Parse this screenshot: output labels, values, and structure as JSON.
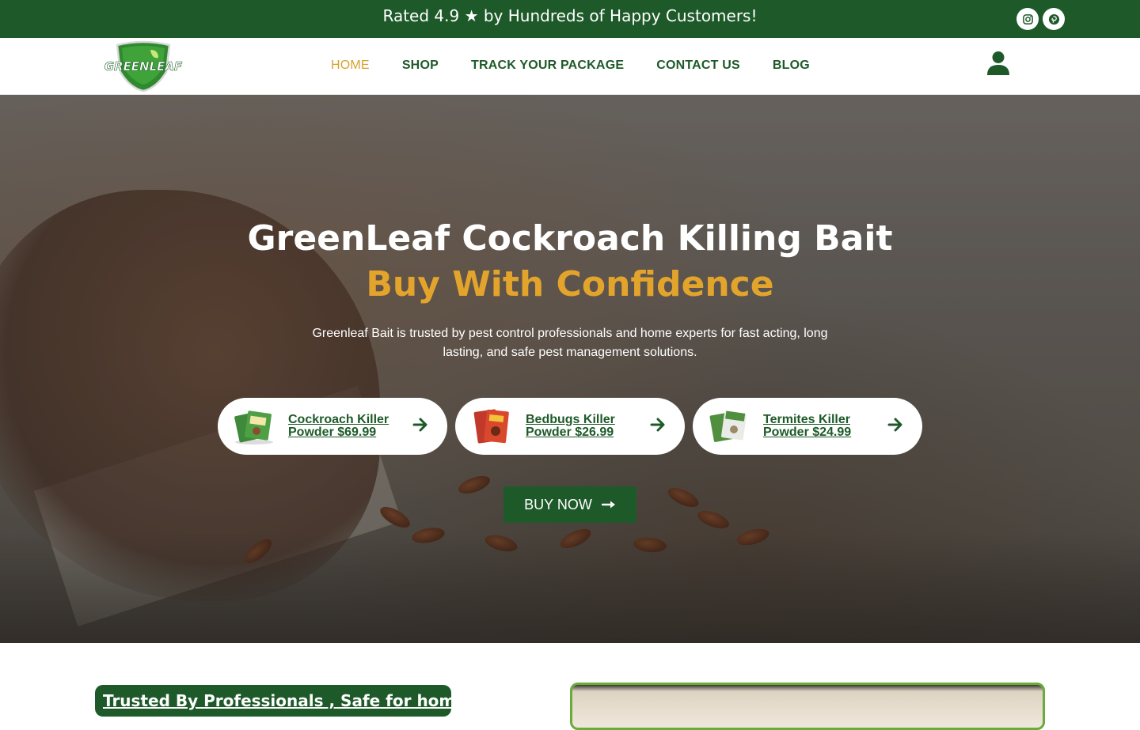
{
  "topbar": {
    "announcement": "Rated 4.9 ★ by Hundreds of Happy Customers!",
    "social": [
      {
        "name": "instagram",
        "icon": "instagram-icon"
      },
      {
        "name": "pinterest",
        "icon": "pinterest-icon"
      }
    ]
  },
  "header": {
    "logo_text": "GREENLEAF",
    "nav": [
      {
        "label": "HOME",
        "active": true
      },
      {
        "label": "SHOP",
        "active": false
      },
      {
        "label": "TRACK YOUR PACKAGE",
        "active": false
      },
      {
        "label": "CONTACT US",
        "active": false
      },
      {
        "label": "BLOG",
        "active": false
      }
    ],
    "account_icon": "user-icon"
  },
  "hero": {
    "title": "GreenLeaf Cockroach Killing Bait",
    "subtitle": "Buy With Confidence",
    "description": "Greenleaf Bait is trusted by pest control professionals and home experts for fast acting, long lasting, and safe pest management solutions.",
    "products": [
      {
        "label": "Cockroach Killer Powder $69.99",
        "thumb_color": "#3f8a3a"
      },
      {
        "label": "Bedbugs Killer Powder $26.99",
        "thumb_color": "#c0392b"
      },
      {
        "label": "Termites Killer Powder $24.99",
        "thumb_color": "#4f8f3e"
      }
    ],
    "cta": "BUY NOW"
  },
  "section": {
    "badge": "Trusted By Professionals , Safe for home use"
  },
  "colors": {
    "brand_green": "#1e5a29",
    "accent_gold": "#e3a42c",
    "nav_active": "#d7a22b",
    "border_green": "#6aab3a"
  }
}
